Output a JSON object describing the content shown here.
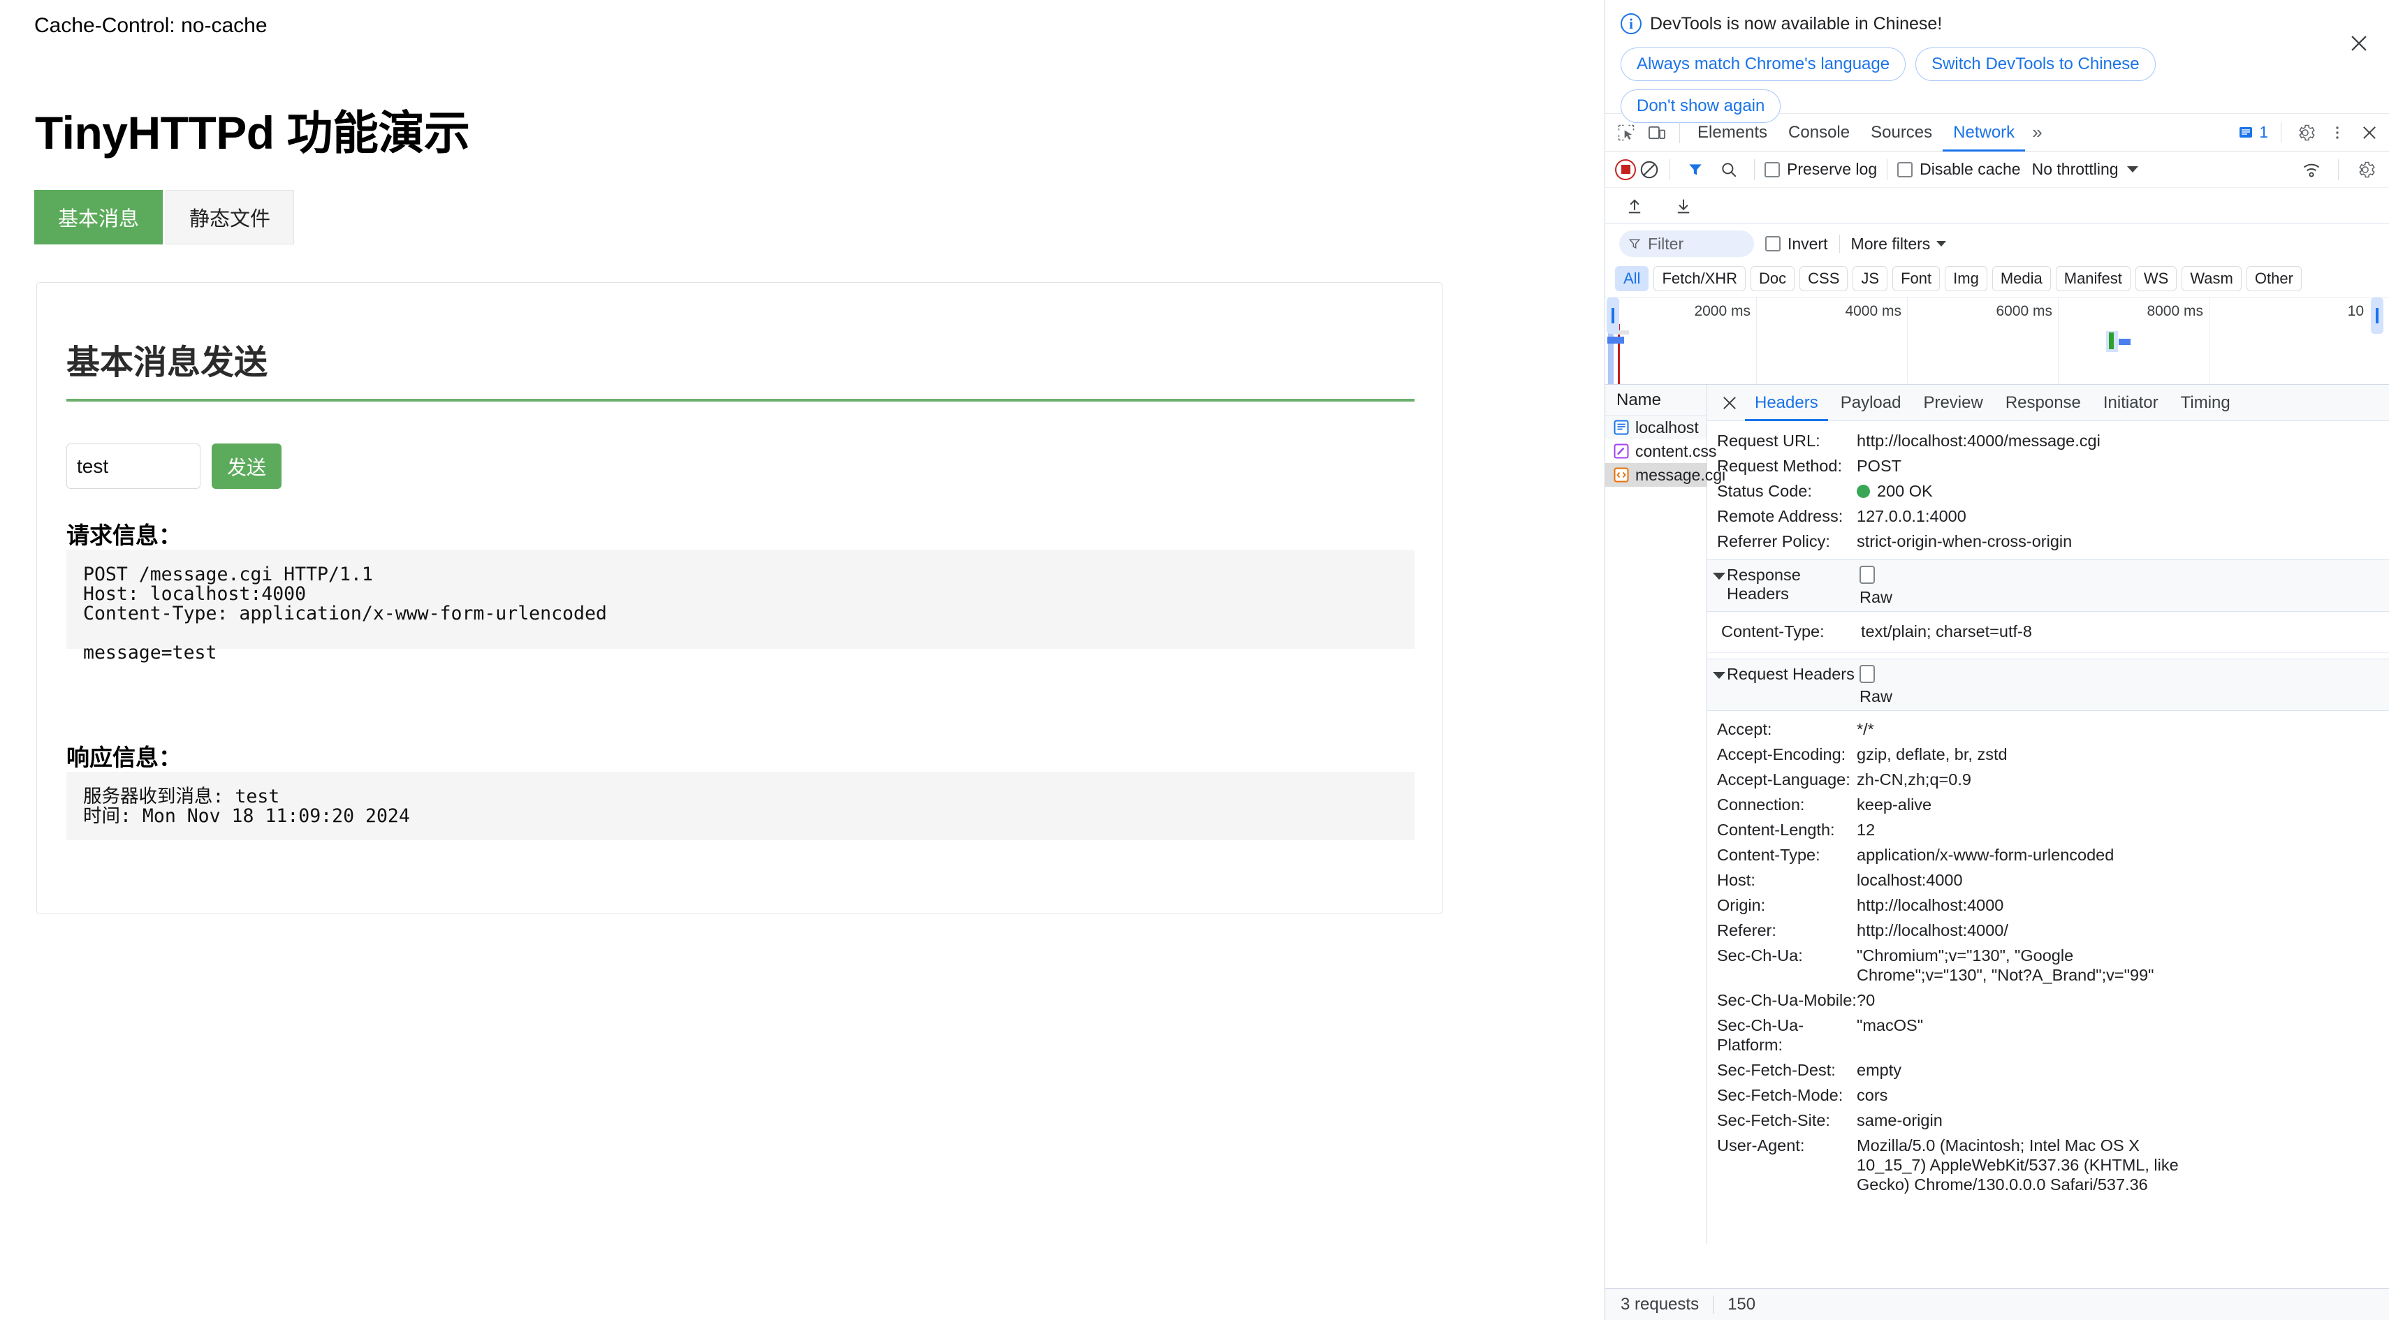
{
  "page": {
    "cache_header": "Cache-Control: no-cache",
    "title": "TinyHTTPd 功能演示",
    "tabs": [
      {
        "label": "基本消息",
        "active": true
      },
      {
        "label": "静态文件",
        "active": false
      }
    ],
    "card": {
      "heading": "基本消息发送",
      "input_value": "test",
      "input_placeholder": "",
      "send_label": "发送",
      "request_label": "请求信息：",
      "request_text": "POST /message.cgi HTTP/1.1\nHost: localhost:4000\nContent-Type: application/x-www-form-urlencoded\n\nmessage=test",
      "response_label": "响应信息：",
      "response_text": "服务器收到消息: test\n时间: Mon Nov 18 11:09:20 2024"
    }
  },
  "devtools": {
    "banner": {
      "message": "DevTools is now available in Chinese!",
      "chips": [
        "Always match Chrome's language",
        "Switch DevTools to Chinese",
        "Don't show again"
      ],
      "close_label": "✕"
    },
    "tabs": [
      {
        "label": "Elements",
        "active": false
      },
      {
        "label": "Console",
        "active": false
      },
      {
        "label": "Sources",
        "active": false
      },
      {
        "label": "Network",
        "active": true
      }
    ],
    "more_tabs_glyph": "»",
    "message_count": "1",
    "toolbar": {
      "preserve_log": "Preserve log",
      "preserve_log_checked": false,
      "disable_cache": "Disable cache",
      "disable_cache_checked": false,
      "throttling": "No throttling"
    },
    "filter": {
      "placeholder": "Filter",
      "value": "",
      "invert": "Invert",
      "invert_checked": false,
      "more_filters": "More filters"
    },
    "type_chips": [
      {
        "label": "All",
        "selected": true
      },
      {
        "label": "Fetch/XHR",
        "selected": false
      },
      {
        "label": "Doc",
        "selected": false
      },
      {
        "label": "CSS",
        "selected": false
      },
      {
        "label": "JS",
        "selected": false
      },
      {
        "label": "Font",
        "selected": false
      },
      {
        "label": "Img",
        "selected": false
      },
      {
        "label": "Media",
        "selected": false
      },
      {
        "label": "Manifest",
        "selected": false
      },
      {
        "label": "WS",
        "selected": false
      },
      {
        "label": "Wasm",
        "selected": false
      },
      {
        "label": "Other",
        "selected": false
      }
    ],
    "overview": {
      "ticks": [
        "2000 ms",
        "4000 ms",
        "6000 ms",
        "8000 ms",
        "10"
      ]
    },
    "request_list": {
      "column_header": "Name",
      "items": [
        {
          "name": "localhost",
          "icon": "document-icon",
          "selected": false
        },
        {
          "name": "content.css",
          "icon": "stylesheet-icon",
          "selected": false
        },
        {
          "name": "message.cgi",
          "icon": "code-icon",
          "selected": true
        }
      ]
    },
    "detail_tabs": [
      {
        "label": "Headers",
        "active": true
      },
      {
        "label": "Payload",
        "active": false
      },
      {
        "label": "Preview",
        "active": false
      },
      {
        "label": "Response",
        "active": false
      },
      {
        "label": "Initiator",
        "active": false
      },
      {
        "label": "Timing",
        "active": false
      }
    ],
    "general": [
      {
        "key": "Request URL:",
        "value": "http://localhost:4000/message.cgi"
      },
      {
        "key": "Request Method:",
        "value": "POST"
      },
      {
        "key": "Status Code:",
        "value": "200 OK",
        "dot": "#3aa757"
      },
      {
        "key": "Remote Address:",
        "value": "127.0.0.1:4000"
      },
      {
        "key": "Referrer Policy:",
        "value": "strict-origin-when-cross-origin"
      }
    ],
    "response_headers": {
      "title": "Response Headers",
      "raw_label": "Raw",
      "raw_checked": false,
      "rows": [
        {
          "key": "Content-Type:",
          "value": "text/plain; charset=utf-8"
        }
      ]
    },
    "request_headers": {
      "title": "Request Headers",
      "raw_label": "Raw",
      "raw_checked": false,
      "rows": [
        {
          "key": "Accept:",
          "value": "*/*"
        },
        {
          "key": "Accept-Encoding:",
          "value": "gzip, deflate, br, zstd"
        },
        {
          "key": "Accept-Language:",
          "value": "zh-CN,zh;q=0.9"
        },
        {
          "key": "Connection:",
          "value": "keep-alive"
        },
        {
          "key": "Content-Length:",
          "value": "12"
        },
        {
          "key": "Content-Type:",
          "value": "application/x-www-form-urlencoded"
        },
        {
          "key": "Host:",
          "value": "localhost:4000"
        },
        {
          "key": "Origin:",
          "value": "http://localhost:4000"
        },
        {
          "key": "Referer:",
          "value": "http://localhost:4000/"
        },
        {
          "key": "Sec-Ch-Ua:",
          "value": "\"Chromium\";v=\"130\", \"Google Chrome\";v=\"130\", \"Not?A_Brand\";v=\"99\""
        },
        {
          "key": "Sec-Ch-Ua-Mobile:",
          "value": "?0"
        },
        {
          "key": "Sec-Ch-Ua-Platform:",
          "value": "\"macOS\""
        },
        {
          "key": "Sec-Fetch-Dest:",
          "value": "empty"
        },
        {
          "key": "Sec-Fetch-Mode:",
          "value": "cors"
        },
        {
          "key": "Sec-Fetch-Site:",
          "value": "same-origin"
        },
        {
          "key": "User-Agent:",
          "value": "Mozilla/5.0 (Macintosh; Intel Mac OS X 10_15_7) AppleWebKit/537.36 (KHTML, like Gecko) Chrome/130.0.0.0 Safari/537.36"
        }
      ]
    },
    "status_bar": {
      "requests": "3 requests",
      "transferred": "150"
    },
    "colors": {
      "accent": "#1a73e8",
      "record": "#c5221f",
      "status_ok": "#3aa757",
      "chip_selected_bg": "#d3e3fd"
    }
  }
}
